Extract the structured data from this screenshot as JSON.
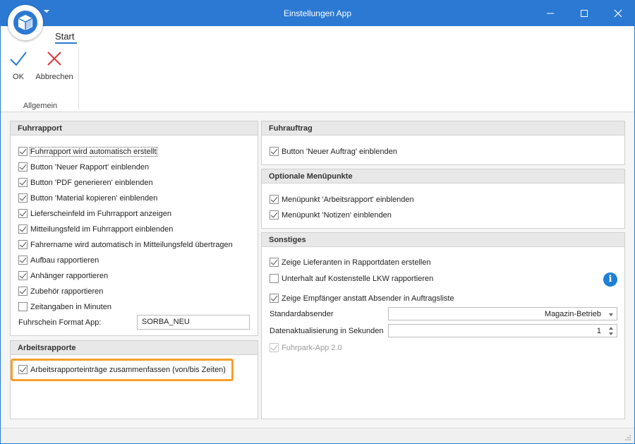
{
  "window": {
    "title": "Einstellungen App"
  },
  "ribbon": {
    "tab_start": "Start",
    "ok_label": "OK",
    "cancel_label": "Abbrechen",
    "group_label": "Allgemein"
  },
  "fuhrrapport": {
    "title": "Fuhrrapport",
    "items": [
      {
        "label": "Fuhrrapport wird automatisch erstellt",
        "checked": true
      },
      {
        "label": "Button 'Neuer Rapport' einblenden",
        "checked": true
      },
      {
        "label": "Button 'PDF generieren' einblenden",
        "checked": true
      },
      {
        "label": "Button 'Material kopieren' einblenden",
        "checked": true
      },
      {
        "label": "Lieferscheinfeld im Fuhrrapport anzeigen",
        "checked": true
      },
      {
        "label": "Mitteilungsfeld im Fuhrrapport einblenden",
        "checked": true
      },
      {
        "label": "Fahrername wird automatisch in Mitteilungsfeld übertragen",
        "checked": true
      },
      {
        "label": "Aufbau rapportieren",
        "checked": true
      },
      {
        "label": "Anhänger rapportieren",
        "checked": true
      },
      {
        "label": "Zubehör rapportieren",
        "checked": true
      },
      {
        "label": "Zeitangaben in Minuten",
        "checked": false
      }
    ],
    "format_label": "Fuhrschein Format App:",
    "format_value": "SORBA_NEU"
  },
  "arbeitsrapporte": {
    "title": "Arbeitsrapporte",
    "items": [
      {
        "label": "Arbeitsrapporteinträge zusammenfassen (von/bis Zeiten)",
        "checked": true
      }
    ]
  },
  "fuhrauftrag": {
    "title": "Fuhrauftrag",
    "items": [
      {
        "label": "Button 'Neuer Auftrag' einblenden",
        "checked": true
      }
    ]
  },
  "optionale_menuepunkte": {
    "title": "Optionale Menüpunkte",
    "items": [
      {
        "label": "Menüpunkt 'Arbeitsrapport' einblenden",
        "checked": true
      },
      {
        "label": "Menüpunkt 'Notizen' einblenden",
        "checked": true
      }
    ]
  },
  "sonstiges": {
    "title": "Sonstiges",
    "items": [
      {
        "label": "Zeige Lieferanten in Rapportdaten erstellen",
        "checked": true
      },
      {
        "label": "Unterhalt auf Kostenstelle LKW rapportieren",
        "checked": false
      },
      {
        "label": "Zeige Empfänger anstatt Absender in Auftragsliste",
        "checked": true
      }
    ],
    "standardabsender_label": "Standardabsender",
    "standardabsender_value": "Magazin-Betrieb",
    "datenaktualisierung_label": "Datenaktualisierung in Sekunden",
    "datenaktualisierung_value": "1",
    "fuhrpark_label": "Fuhrpark-App 2.0",
    "fuhrpark_checked": true,
    "info_glyph": "i"
  },
  "colors": {
    "titlebar": "#2b79d3",
    "highlight": "#f5a02a",
    "ok_check": "#2b79d3",
    "cancel_x": "#e0393e",
    "info": "#1e7fd4"
  }
}
